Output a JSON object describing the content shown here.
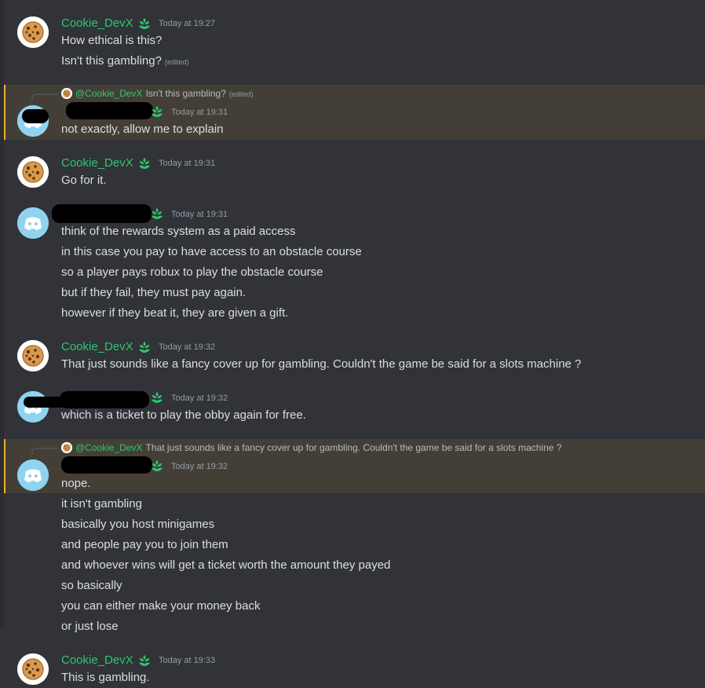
{
  "colors": {
    "background": "#313338",
    "username": "#2dc770",
    "mention_highlight": "#443f36",
    "mention_bar": "#f0b232",
    "timestamp": "#949ba4"
  },
  "icons": {
    "cookie_avatar": "cookie-icon",
    "default_avatar": "discord-default-avatar-icon",
    "badge": "green-leaf-badge-icon"
  },
  "messages": {
    "m1": {
      "author": "Cookie_DevX",
      "time": "Today at 19:27",
      "lines": [
        "How ethical is this?",
        "Isn't this gambling?"
      ],
      "edited": "(edited)"
    },
    "m2": {
      "reply": {
        "mention": "@Cookie_DevX",
        "text": "Isn't this gambling?",
        "edited": "(edited)"
      },
      "time": "Today at 19:31",
      "lines": [
        "not exactly, allow me to explain"
      ]
    },
    "m3": {
      "author": "Cookie_DevX",
      "time": "Today at 19:31",
      "lines": [
        "Go for it."
      ]
    },
    "m4": {
      "time": "Today at 19:31",
      "lines": [
        "think of the rewards system as a paid access",
        "in this case you pay to have access to an obstacle course",
        "so a player pays robux to play the obstacle course",
        "but if they fail, they must pay again.",
        "however if they beat it, they are given a gift."
      ]
    },
    "m5": {
      "author": "Cookie_DevX",
      "time": "Today at 19:32",
      "lines": [
        "That just sounds like a fancy cover up for gambling. Couldn't the game be said for a slots machine ?"
      ]
    },
    "m6": {
      "time": "Today at 19:32",
      "lines": [
        "which is a ticket to play the obby again for free."
      ]
    },
    "m7": {
      "reply": {
        "mention": "@Cookie_DevX",
        "text": "That just sounds like a fancy cover up for gambling. Couldn't the game be said for a slots machine ?"
      },
      "time": "Today at 19:32",
      "lines": [
        "nope.",
        "it isn't gambling",
        "basically you host minigames",
        "and people pay you to join them",
        "and whoever wins will get a ticket worth the amount they payed",
        "so basically",
        "you can either make your money back",
        "or just lose"
      ]
    },
    "m8": {
      "author": "Cookie_DevX",
      "time": "Today at 19:33",
      "lines": [
        "This is gambling."
      ]
    }
  }
}
